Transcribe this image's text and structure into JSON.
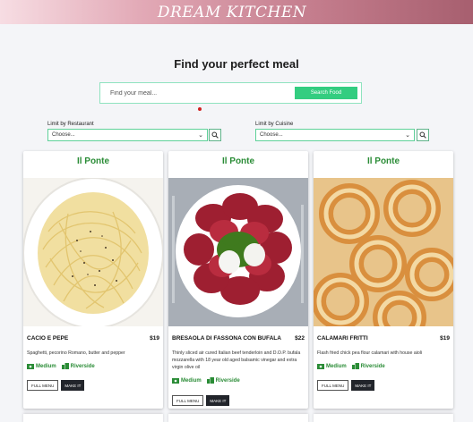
{
  "banner": {
    "title": "DREAM KITCHEN"
  },
  "headline": "Find your perfect meal",
  "search": {
    "placeholder": "Find your meal...",
    "button_label": "Search Food"
  },
  "filters": {
    "restaurant": {
      "label": "Limit by Restaurant",
      "selected": "Choose..."
    },
    "cuisine": {
      "label": "Limit by Cuisine",
      "selected": "Choose..."
    }
  },
  "cards": [
    {
      "restaurant": "Il Ponte",
      "name": "CACIO E PEPE",
      "price": "$19",
      "description": "Spaghetti, pecorino Romano, butter and pepper",
      "size": "Medium",
      "location": "Riverside",
      "full_menu_label": "FULL MENU",
      "make_it_label": "MAKE IT"
    },
    {
      "restaurant": "Il Ponte",
      "name": "BRESAOLA DI FASSONA CON BUFALA",
      "price": "$22",
      "description": "Thinly sliced air cured Italian beef tenderloin and D.O.P. bufala mozzarella with 18 year old aged balsamic vinegar and extra virgin olive oil",
      "size": "Medium",
      "location": "Riverside",
      "full_menu_label": "FULL MENU",
      "make_it_label": "MAKE IT"
    },
    {
      "restaurant": "Il Ponte",
      "name": "CALAMARI FRITTI",
      "price": "$19",
      "description": "Flash fried chick pea flour calamari with house aioli",
      "size": "Medium",
      "location": "Riverside",
      "full_menu_label": "FULL MENU",
      "make_it_label": "MAKE IT"
    }
  ],
  "colors": {
    "accent": "#2a8c36",
    "search_button": "#33cd80",
    "banner": "#c57e8e"
  },
  "icons": {
    "search": "search-icon",
    "chevron": "chevron-down-icon",
    "size": "cash-icon",
    "location": "city-icon"
  }
}
